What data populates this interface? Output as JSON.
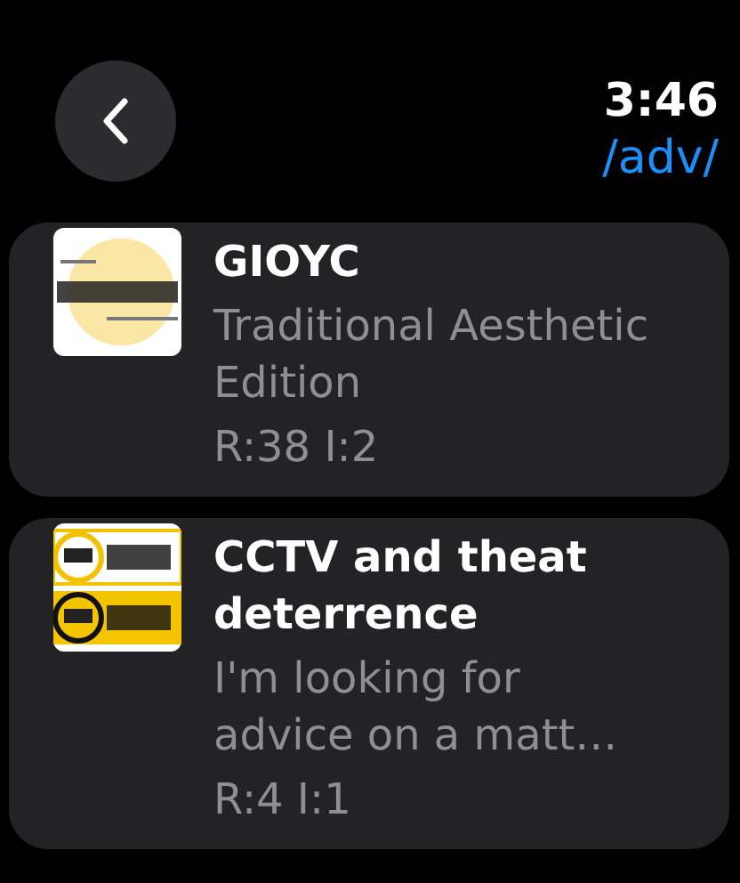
{
  "header": {
    "time": "3:46",
    "board": "/adv/"
  },
  "threads": [
    {
      "title": "GIOYC",
      "excerpt": "Traditional Aesthetic Edition",
      "stats": "R:38 I:2"
    },
    {
      "title": "CCTV and theat deterrence",
      "excerpt": "I'm looking for advice on a matt…",
      "stats": "R:4 I:1"
    }
  ]
}
